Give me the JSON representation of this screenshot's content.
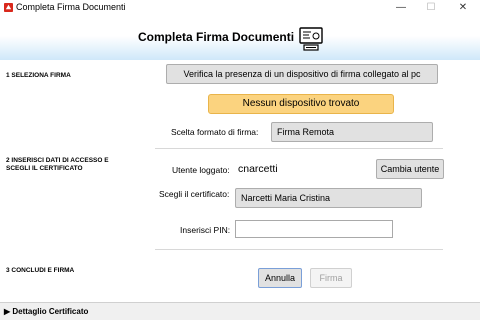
{
  "window": {
    "title": "Completa Firma Documenti",
    "minimize": "—",
    "maximize": "☐",
    "close": "✕"
  },
  "header": {
    "title": "Completa Firma Documenti"
  },
  "sections": {
    "s1": "1 SELEZIONA FIRMA",
    "s2": "2 INSERISCI DATI DI ACCESSO E SCEGLI IL CERTIFICATO",
    "s3": "3 CONCLUDI E FIRMA"
  },
  "select_firma": {
    "verify_button": "Verifica la presenza di un dispositivo di firma collegato al pc",
    "warning": "Nessun dispositivo trovato",
    "format_label": "Scelta formato di firma:",
    "format_value": "Firma Remota"
  },
  "access": {
    "user_label": "Utente loggato:",
    "user_value": "cnarcetti",
    "change_user_button": "Cambia utente",
    "cert_label": "Scegli il certificato:",
    "cert_value": "Narcetti Maria Cristina",
    "pin_label": "Inserisci PIN:",
    "pin_value": ""
  },
  "actions": {
    "cancel": "Annulla",
    "sign": "Firma"
  },
  "footer": {
    "toggle": "▶ Dettaglio Certificato"
  },
  "colors": {
    "warning_bg": "#fbd37f",
    "header_gradient_end": "#cfe8f9"
  }
}
